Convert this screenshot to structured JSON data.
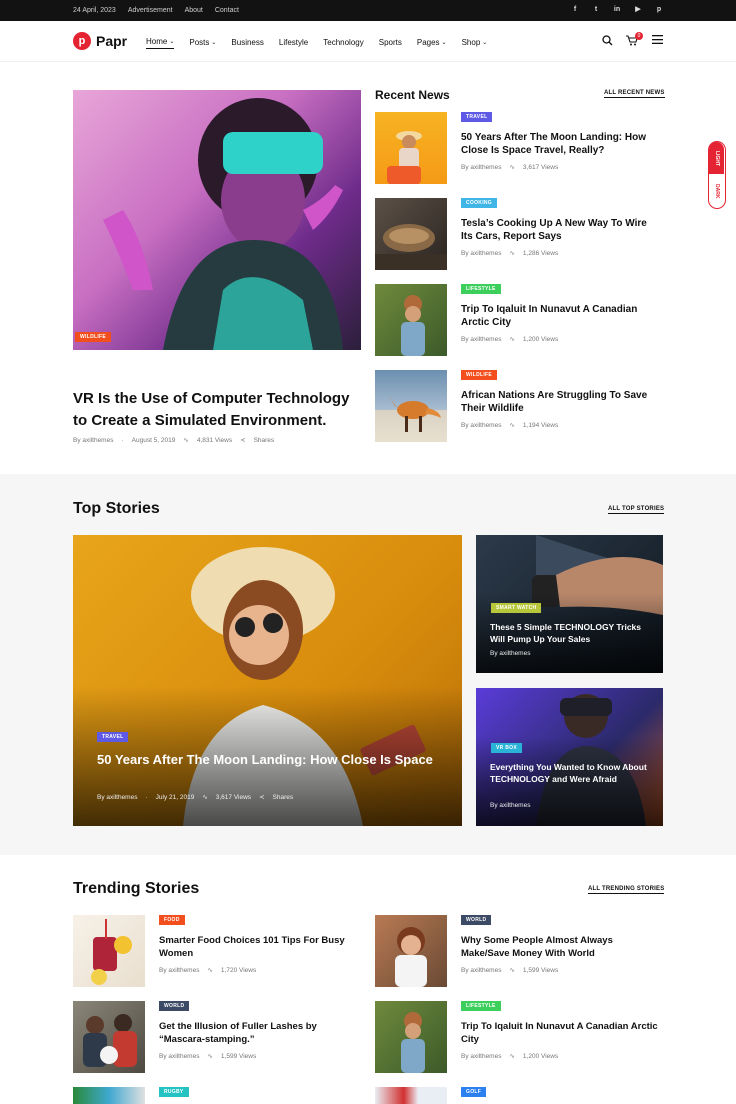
{
  "topbar": {
    "date": "24 April, 2023",
    "links": [
      "Advertisement",
      "About",
      "Contact"
    ],
    "social": [
      "facebook-icon",
      "twitter-icon",
      "linkedin-icon",
      "youtube-icon",
      "pinterest-icon"
    ],
    "social_glyphs": [
      "f",
      "t",
      "in",
      "▶",
      "p"
    ]
  },
  "header": {
    "logo_mark": "p",
    "logo_text": "Papr",
    "nav": [
      {
        "label": "Home",
        "chevron": true,
        "active": true
      },
      {
        "label": "Posts",
        "chevron": true
      },
      {
        "label": "Business",
        "chevron": false
      },
      {
        "label": "Lifestyle",
        "chevron": false
      },
      {
        "label": "Technology",
        "chevron": false
      },
      {
        "label": "Sports",
        "chevron": false
      },
      {
        "label": "Pages",
        "chevron": true
      },
      {
        "label": "Shop",
        "chevron": true
      }
    ],
    "cart_count": "0"
  },
  "hero": {
    "badge": "WILDLIFE",
    "title": "VR Is the Use of Computer Technology to Create a Simulated Environment.",
    "author": "By axilthemes",
    "date": "August 5, 2019",
    "views": "4,831 Views",
    "shares": "Shares"
  },
  "recent": {
    "title": "Recent News",
    "link": "ALL RECENT NEWS",
    "items": [
      {
        "badge": "TRAVEL",
        "title": "50 Years After The Moon Landing: How Close Is Space Travel, Really?",
        "author": "By axilthemes",
        "views": "3,617 Views"
      },
      {
        "badge": "COOKING",
        "title": "Tesla’s Cooking Up A New Way To Wire Its Cars, Report Says",
        "author": "By axilthemes",
        "views": "1,286 Views"
      },
      {
        "badge": "LIFESTYLE",
        "title": "Trip To Iqaluit In Nunavut A Canadian Arctic City",
        "author": "By axilthemes",
        "views": "1,200 Views"
      },
      {
        "badge": "WILDLIFE",
        "title": "African Nations Are Struggling To Save Their Wildlife",
        "author": "By axilthemes",
        "views": "1,194 Views"
      }
    ]
  },
  "toggle": {
    "light": "LIGHT",
    "dark": "DARK"
  },
  "top_stories": {
    "title": "Top Stories",
    "link": "ALL TOP STORIES",
    "main": {
      "badge": "TRAVEL",
      "title": "50 Years After The Moon Landing: How Close Is Space",
      "author": "By axilthemes",
      "date": "July 21, 2019",
      "views": "3,617 Views",
      "shares": "Shares"
    },
    "side": [
      {
        "badge": "SMART WATCH",
        "title": "These 5 Simple TECHNOLOGY Tricks Will Pump Up Your Sales",
        "author": "By axilthemes"
      },
      {
        "badge": "VR BOX",
        "title": "Everything You Wanted to Know About TECHNOLOGY and Were Afraid",
        "author": "By axilthemes"
      }
    ]
  },
  "trending": {
    "title": "Trending Stories",
    "link": "ALL TRENDING STORIES",
    "items": [
      {
        "badge": "FOOD",
        "title": "Smarter Food Choices 101 Tips For Busy Women",
        "author": "By axilthemes",
        "views": "1,720 Views"
      },
      {
        "badge": "WORLD",
        "title": "Why Some People Almost Always Make/Save Money With World",
        "author": "By axilthemes",
        "views": "1,599 Views"
      },
      {
        "badge": "WORLD",
        "title": "Get the Illusion of Fuller Lashes by “Mascara-stamping.”",
        "author": "By axilthemes",
        "views": "1,599 Views"
      },
      {
        "badge": "LIFESTYLE",
        "title": "Trip To Iqaluit In Nunavut A Canadian Arctic City",
        "author": "By axilthemes",
        "views": "1,200 Views"
      },
      {
        "badge": "RUGBY",
        "title": "",
        "author": "",
        "views": ""
      },
      {
        "badge": "GOLF",
        "title": "",
        "author": "",
        "views": ""
      }
    ]
  },
  "colors": {
    "accent": "#e42333",
    "topbar": "#121212",
    "section_bg": "#f6f6f6"
  }
}
